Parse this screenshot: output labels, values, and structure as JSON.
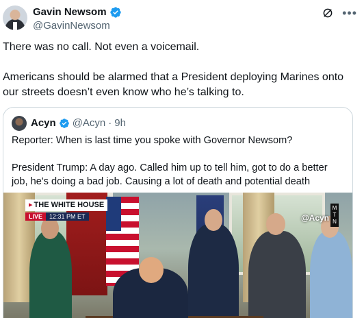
{
  "post": {
    "display_name": "Gavin Newsom",
    "handle": "@GavinNewsom",
    "text": "There was no call. Not even a voicemail.\n\nAmericans should be alarmed that a President deploying Marines onto our streets doesn’t even know who he’s talking to."
  },
  "quoted": {
    "display_name": "Acyn",
    "handle": "@Acyn",
    "separator": "·",
    "time": "9h",
    "text": "Reporter: When is last time you spoke with Governor Newsom?\n\nPresident Trump: A day ago. Called him up to tell him, got to do a better job, he's doing a bad job. Causing a lot of death and potential death"
  },
  "media": {
    "chyron_title": "THE WHITE HOUSE",
    "live_label": "LIVE",
    "live_time": "12:31 PM ET",
    "watermark": "@Acyn",
    "network_tag": "M T N"
  },
  "icons": {
    "verified": "verified-badge-icon",
    "grok": "grok-icon",
    "more": "more-options-icon"
  },
  "colors": {
    "verified_blue": "#1d9bf0",
    "secondary_text": "#536471",
    "border": "#cfd9de",
    "live_red": "#c8102e"
  }
}
